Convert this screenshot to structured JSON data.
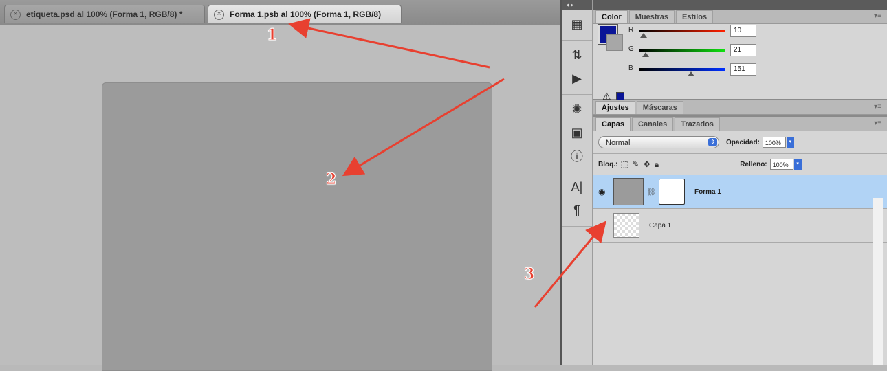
{
  "documentTabs": {
    "inactive": {
      "title": "etiqueta.psd al 100% (Forma 1, RGB/8) *"
    },
    "active": {
      "title": "Forma 1.psb al 100% (Forma 1, RGB/8)"
    }
  },
  "colorPanel": {
    "tabs": [
      "Color",
      "Muestras",
      "Estilos"
    ],
    "foreground": "#0a1597",
    "background": "#a7a7a7",
    "channels": [
      {
        "label": "R",
        "value": "10"
      },
      {
        "label": "G",
        "value": "21"
      },
      {
        "label": "B",
        "value": "151"
      }
    ]
  },
  "adjustPanel": {
    "tabs": [
      "Ajustes",
      "Máscaras"
    ]
  },
  "layersPanel": {
    "tabs": [
      "Capas",
      "Canales",
      "Trazados"
    ],
    "blendMode": "Normal",
    "opacityLabel": "Opacidad:",
    "opacityValue": "100%",
    "lockLabel": "Bloq.:",
    "fillLabel": "Relleno:",
    "fillValue": "100%",
    "layers": [
      {
        "name": "Forma 1",
        "selected": true
      },
      {
        "name": "Capa 1",
        "selected": false
      }
    ]
  },
  "annotations": {
    "one": "1",
    "two": "2",
    "three": "3",
    "color": "#e84030"
  },
  "icons": [
    "histogram-icon",
    "actions-icon",
    "play-icon",
    "sun-icon",
    "image-icon",
    "info-icon",
    "character-icon",
    "paragraph-icon"
  ]
}
